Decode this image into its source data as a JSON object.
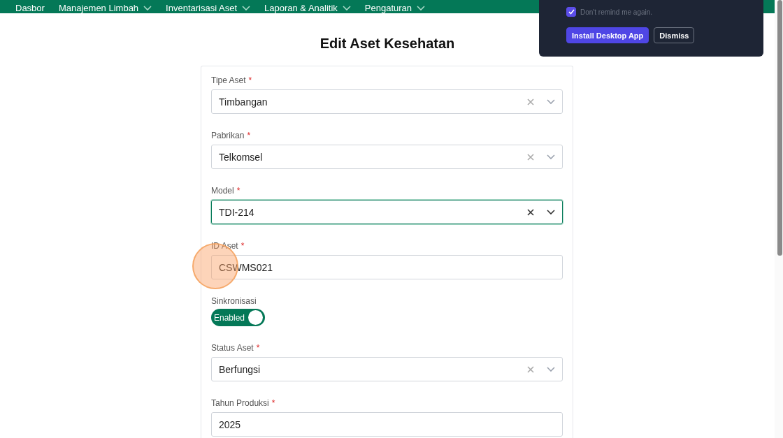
{
  "nav": [
    {
      "label": "Dasbor",
      "dropdown": false
    },
    {
      "label": "Manajemen Limbah",
      "dropdown": true
    },
    {
      "label": "Inventarisasi Aset",
      "dropdown": true
    },
    {
      "label": "Laporan & Analitik",
      "dropdown": true
    },
    {
      "label": "Pengaturan",
      "dropdown": true
    }
  ],
  "popup": {
    "checkbox": {
      "label": "Don't remind me again.",
      "checked": true
    },
    "buttons": [
      {
        "label": "Install Desktop App",
        "kind": "primary"
      },
      {
        "label": "Dismiss",
        "kind": "secondary"
      }
    ]
  },
  "title": "Edit Aset Kesehatan",
  "fields": [
    {
      "kind": "select",
      "label": "Tipe Aset",
      "required_mark": "*",
      "value": "Timbangan",
      "focused": false
    },
    {
      "kind": "select",
      "label": "Pabrikan",
      "required_mark": "*",
      "value": "Telkomsel",
      "focused": false
    },
    {
      "kind": "select",
      "label": "Model",
      "required_mark": "*",
      "value": "TDI-214",
      "focused": true
    },
    {
      "kind": "text",
      "label": "ID Aset",
      "required_mark": "*",
      "value": "CSWMS021",
      "focused": false
    },
    {
      "kind": "toggle",
      "label": "Sinkronisasi",
      "value": "Enabled",
      "on": true
    },
    {
      "kind": "select",
      "label": "Status Aset",
      "required_mark": "*",
      "value": "Berfungsi",
      "focused": false
    },
    {
      "kind": "text",
      "label": "Tahun Produksi",
      "required_mark": "*",
      "value": "2025",
      "focused": false
    }
  ]
}
